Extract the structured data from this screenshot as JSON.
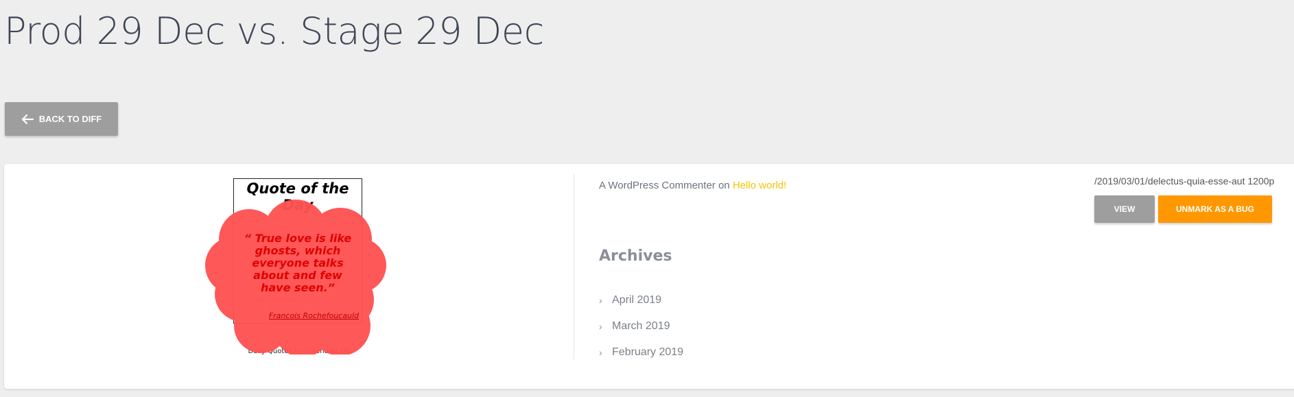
{
  "page": {
    "title": "Prod 29 Dec vs. Stage 29 Dec",
    "back_button": {
      "label": "BACK TO DIFF",
      "icon": "arrow-left-icon"
    }
  },
  "screenshot": {
    "quote_widget": {
      "title": "Quote of the Day",
      "quote": "“ True love is like ghosts, which everyone talks about and few have seen.”",
      "author": "Francois Rochefoucauld",
      "credit": "Daily Quotes by CalendarLabs",
      "highlight_color": "#ff5252"
    },
    "recent_comment": {
      "author": "A WordPress Commenter",
      "connector": "on",
      "post_link": "Hello world!"
    },
    "archives": {
      "title": "Archives",
      "items": [
        "April 2019",
        "March 2019",
        "February 2019"
      ]
    }
  },
  "diff_info": {
    "url": "/2019/03/01/delectus-quia-esse-aut 1200p",
    "view_label": "VIEW",
    "unmark_label": "UNMARK AS A BUG"
  },
  "colors": {
    "background": "#eeeeee",
    "button_gray": "#9e9e9e",
    "button_orange": "#ff9800",
    "link_yellow": "#f5c400",
    "title_text": "#3e4656"
  }
}
